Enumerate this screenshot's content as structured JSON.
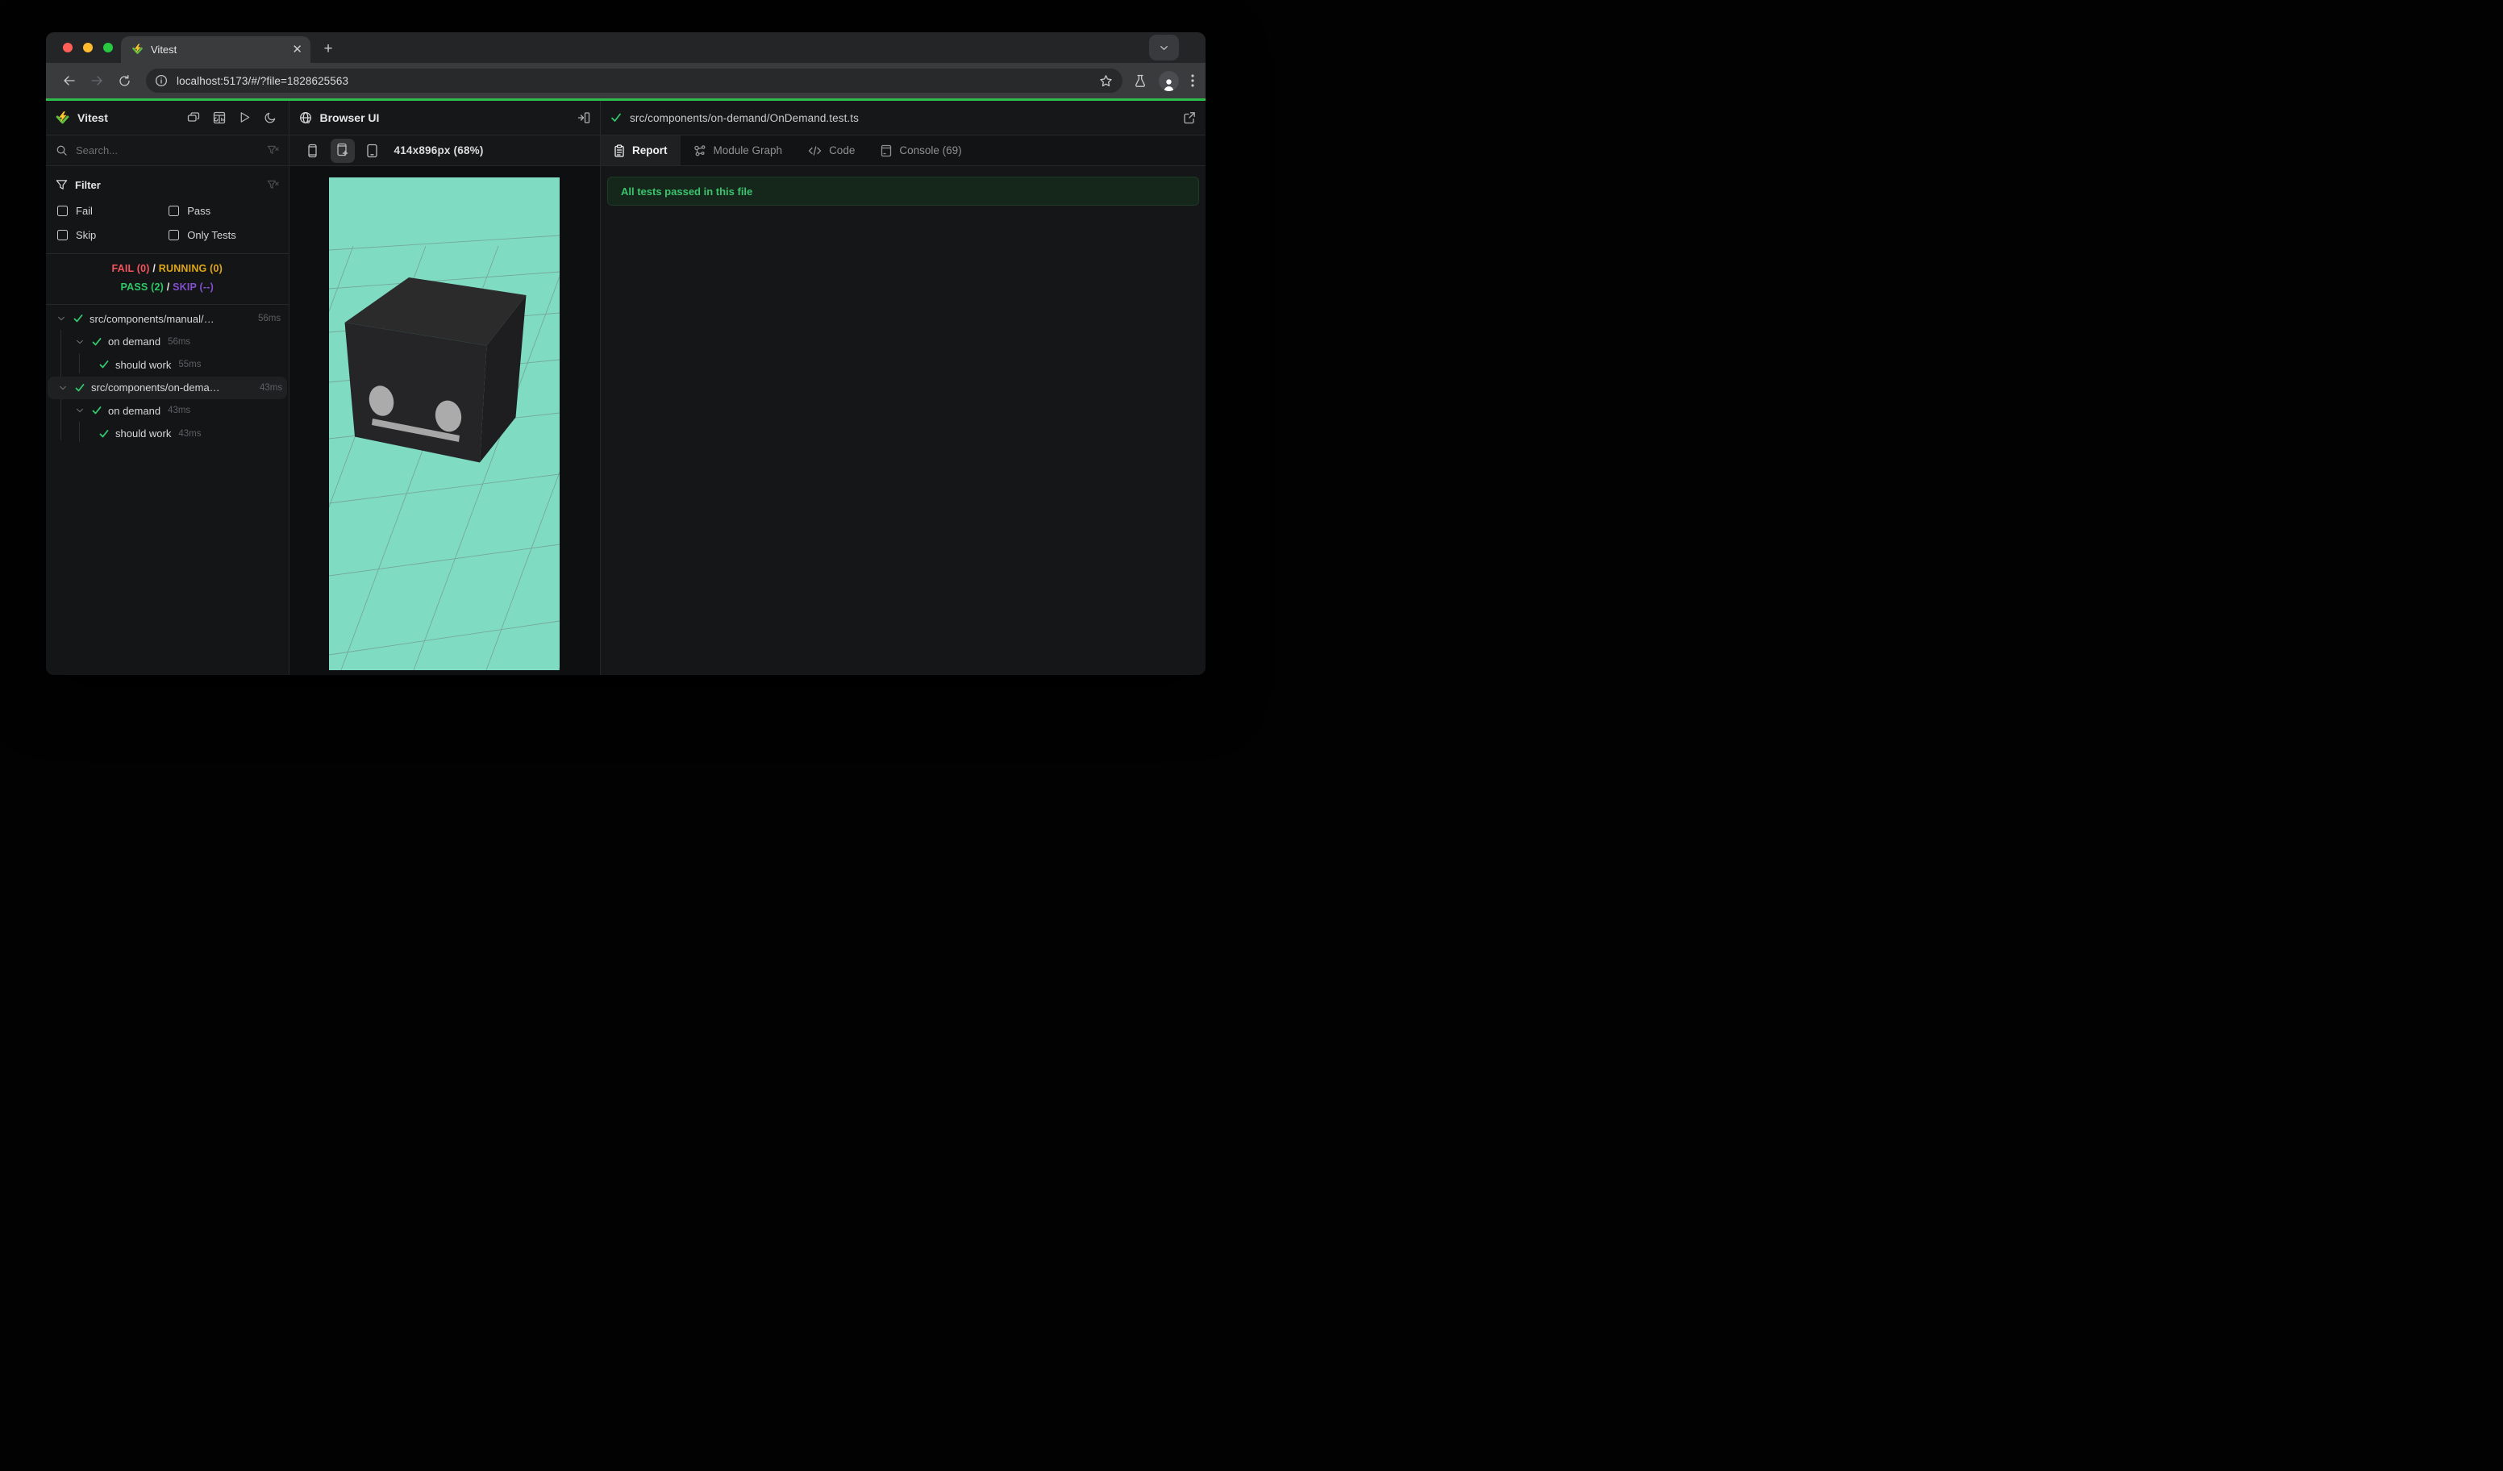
{
  "colors": {
    "accent_green_line": "#2dbd4d",
    "fail": "#f3545e",
    "running": "#dfa716",
    "pass": "#30c767",
    "skip": "#8250cf",
    "check_green": "#34c96e",
    "banner_bg": "#15261b",
    "banner_text": "#3bc46d"
  },
  "browser": {
    "tab_title": "Vitest",
    "url": "localhost:5173/#/?file=1828625563"
  },
  "sidebar": {
    "app_title": "Vitest",
    "search_placeholder": "Search...",
    "filter_title": "Filter",
    "filters": [
      {
        "label": "Fail"
      },
      {
        "label": "Pass"
      },
      {
        "label": "Skip"
      },
      {
        "label": "Only Tests"
      }
    ],
    "summary": {
      "fail": "FAIL (0)",
      "sep1": "/",
      "running": "RUNNING (0)",
      "pass": "PASS (2)",
      "sep2": "/",
      "skip": "SKIP (--)"
    },
    "tree": [
      {
        "label": "src/components/manual/…",
        "time": "56ms"
      },
      {
        "label": "on demand",
        "time": "56ms"
      },
      {
        "label": "should work",
        "time": "55ms"
      },
      {
        "label": "src/components/on-dema…",
        "time": "43ms"
      },
      {
        "label": "on demand",
        "time": "43ms"
      },
      {
        "label": "should work",
        "time": "43ms"
      }
    ]
  },
  "preview": {
    "title": "Browser UI",
    "size_label": "414x896px (68%)",
    "scene": {
      "background": "#7fdcc3",
      "grid": "#6f7d78",
      "cube_top": "#2b2b2c",
      "cube_front": "#252527",
      "cube_side": "#1e1e20",
      "eye": "#ababab",
      "mouth": "#a6a6a6"
    }
  },
  "report": {
    "file_path": "src/components/on-demand/OnDemand.test.ts",
    "tabs": [
      {
        "label": "Report"
      },
      {
        "label": "Module Graph"
      },
      {
        "label": "Code"
      },
      {
        "label": "Console (69)"
      }
    ],
    "banner": "All tests passed in this file"
  }
}
